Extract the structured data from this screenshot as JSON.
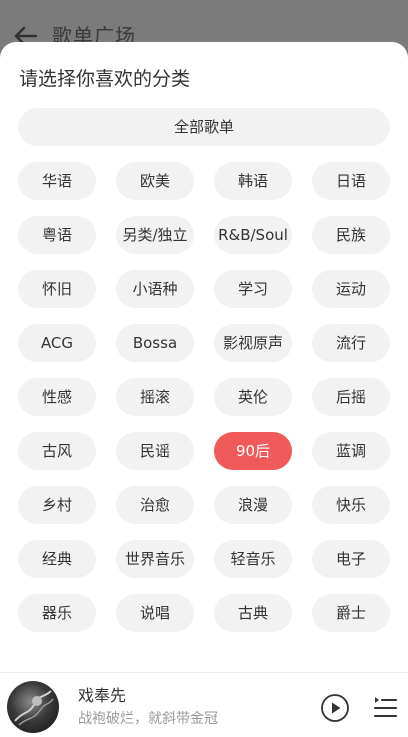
{
  "header": {
    "title": "歌单广场"
  },
  "sheet": {
    "title": "请选择你喜欢的分类",
    "all_label": "全部歌单",
    "categories": [
      "华语",
      "欧美",
      "韩语",
      "日语",
      "粤语",
      "另类/独立",
      "R&B/Soul",
      "民族",
      "怀旧",
      "小语种",
      "学习",
      "运动",
      "ACG",
      "Bossa",
      "影视原声",
      "流行",
      "性感",
      "摇滚",
      "英伦",
      "后摇",
      "古风",
      "民谣",
      "90后",
      "蓝调",
      "乡村",
      "治愈",
      "浪漫",
      "快乐",
      "经典",
      "世界音乐",
      "轻音乐",
      "电子",
      "器乐",
      "说唱",
      "古典",
      "爵士"
    ],
    "selected": "90后"
  },
  "player": {
    "title": "戏奉先",
    "subtitle": "战袍破烂，就斜带金冠"
  },
  "colors": {
    "accent": "#f05a5a",
    "chip_bg": "#f2f2f2",
    "backdrop": "#7b7b7b"
  }
}
